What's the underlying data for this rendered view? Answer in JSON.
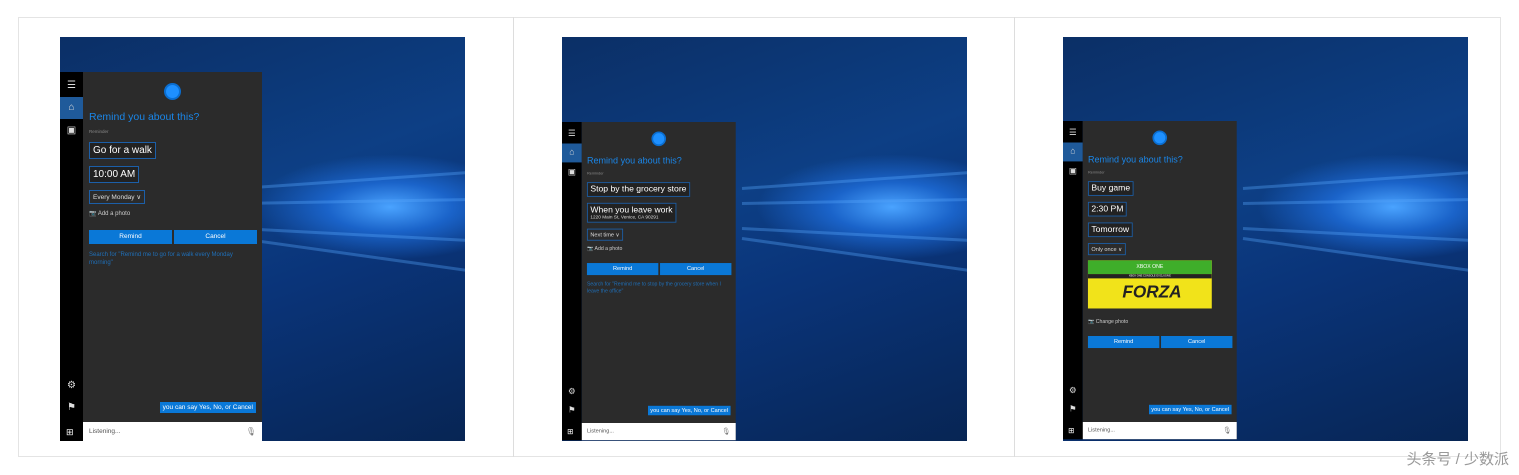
{
  "watermark": "头条号 / 少数派",
  "panels": [
    {
      "title": "Remind you about this?",
      "subtitle": "Reminder",
      "fields": [
        {
          "text": "Go for a walk"
        },
        {
          "text": "10:00 AM"
        }
      ],
      "repeat": "Every Monday",
      "photo_label": "Add a photo",
      "remind": "Remind",
      "cancel": "Cancel",
      "search": "Search for \"Remind me to go for a walk every Monday morning\"",
      "tip": "you can say Yes, No, or Cancel",
      "listening": "Listening..."
    },
    {
      "title": "Remind you about this?",
      "subtitle": "Reminder",
      "fields": [
        {
          "text": "Stop by the grocery store"
        },
        {
          "text": "When you leave work",
          "detail": "1220 Main St, Venice, CA 90291"
        }
      ],
      "repeat": "Next time",
      "photo_label": "Add a photo",
      "remind": "Remind",
      "cancel": "Cancel",
      "search": "Search for \"Remind me to stop by the grocery store when I leave the office\"",
      "tip": "you can say Yes, No, or Cancel",
      "listening": "Listening..."
    },
    {
      "title": "Remind you about this?",
      "subtitle": "Reminder",
      "fields": [
        {
          "text": "Buy game"
        },
        {
          "text": "2:30 PM"
        },
        {
          "text": "Tomorrow"
        }
      ],
      "repeat": "Only once",
      "image": {
        "brand": "XBOX ONE",
        "banner": "XBOX ONE CONSOLE EXCLUSIVE",
        "game": "FORZA"
      },
      "photo_label": "Change photo",
      "remind": "Remind",
      "cancel": "Cancel",
      "tip": "you can say Yes, No, or Cancel",
      "listening": "Listening..."
    }
  ]
}
